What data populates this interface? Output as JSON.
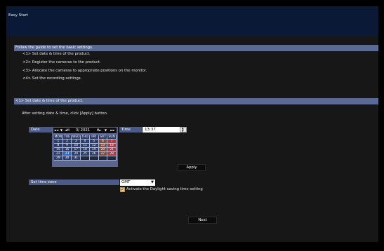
{
  "window": {
    "title": "Easy Start"
  },
  "guide": {
    "header": "Follow the guide to set the basic settings.",
    "steps": [
      "<1> Set date & time of the product.",
      "<2> Register the cameras to the product.",
      "<3> Allocate the cameras to appropriate positions on the monitor.",
      "<4> Set the recording settings."
    ]
  },
  "section1": {
    "header": "<1> Set date & time of the product.",
    "instruction": "After setting date & time, click [Apply] button.",
    "date_label": "Date",
    "time_label": "Time",
    "calendar": {
      "month_year": "3/ 2021",
      "nav": [
        "◄◄",
        "▼",
        "◄M",
        "M►",
        "▼",
        "►►"
      ],
      "weekdays": [
        "MON",
        "TUE",
        "WED",
        "THU",
        "FRI",
        "SAT",
        "SUN"
      ],
      "weeks": [
        [
          "1",
          "2",
          "3",
          "4",
          "5",
          "6",
          "7"
        ],
        [
          "8",
          "9",
          "10",
          "11",
          "12",
          "13",
          "14"
        ],
        [
          "15",
          "16",
          "17",
          "18",
          "19",
          "20",
          "21"
        ],
        [
          "22",
          "23",
          "24",
          "25",
          "26",
          "27",
          "28"
        ],
        [
          "29",
          "30",
          "31",
          "",
          "",
          "",
          ""
        ]
      ],
      "selected_day": "23"
    },
    "time_value": "13:37",
    "apply_label": "Apply",
    "timezone_label": "Set time zone",
    "timezone_value": "GMT",
    "dst_label": "Activate the Daylight saving time setting",
    "dst_checked": true
  },
  "footer": {
    "next_label": "Next"
  },
  "colors": {
    "title_bar": "#0a1a36",
    "section_bar": "#5a6a92",
    "label_box": "#4b5a86",
    "selected_day": "#2c67cc",
    "sunday": "#b5383a",
    "saturday": "#8d4a33"
  }
}
